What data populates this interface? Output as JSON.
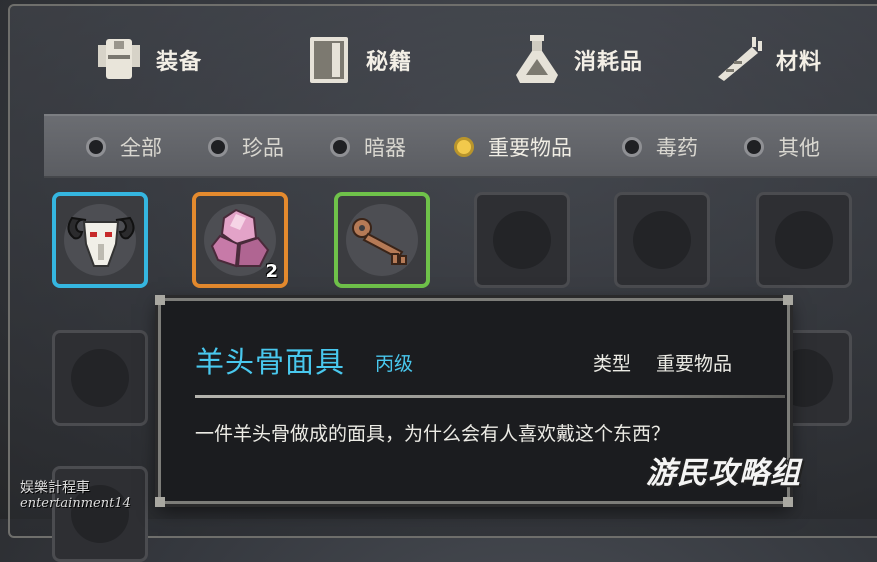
{
  "top_tabs": [
    {
      "label": "装备",
      "icon": "armor-icon",
      "selected": true
    },
    {
      "label": "秘籍",
      "icon": "book-icon"
    },
    {
      "label": "消耗品",
      "icon": "potion-icon"
    },
    {
      "label": "材料",
      "icon": "carrot-icon"
    }
  ],
  "filters": [
    {
      "label": "全部"
    },
    {
      "label": "珍品"
    },
    {
      "label": "暗器"
    },
    {
      "label": "重要物品",
      "selected": true
    },
    {
      "label": "毒药"
    },
    {
      "label": "其他"
    }
  ],
  "slots": [
    {
      "item": "ram-skull-mask-icon",
      "rarity_color": "#35b6e0"
    },
    {
      "item": "pink-crystal-icon",
      "rarity_color": "#e48a2e",
      "count": "2"
    },
    {
      "item": "key-icon",
      "rarity_color": "#6fc24a"
    }
  ],
  "tooltip": {
    "name": "羊头骨面具",
    "grade": "丙级",
    "type_label": "类型",
    "type_value": "重要物品",
    "description": "一件羊头骨做成的面具，为什么会有人喜欢戴这个东西？"
  },
  "watermarks": {
    "left_line1": "娱樂計程車",
    "left_line2": "entertainment14",
    "right": "游民攻略组"
  },
  "colors": {
    "accent_blue": "#49c8ee",
    "selected_filter": "#f2c94c"
  }
}
